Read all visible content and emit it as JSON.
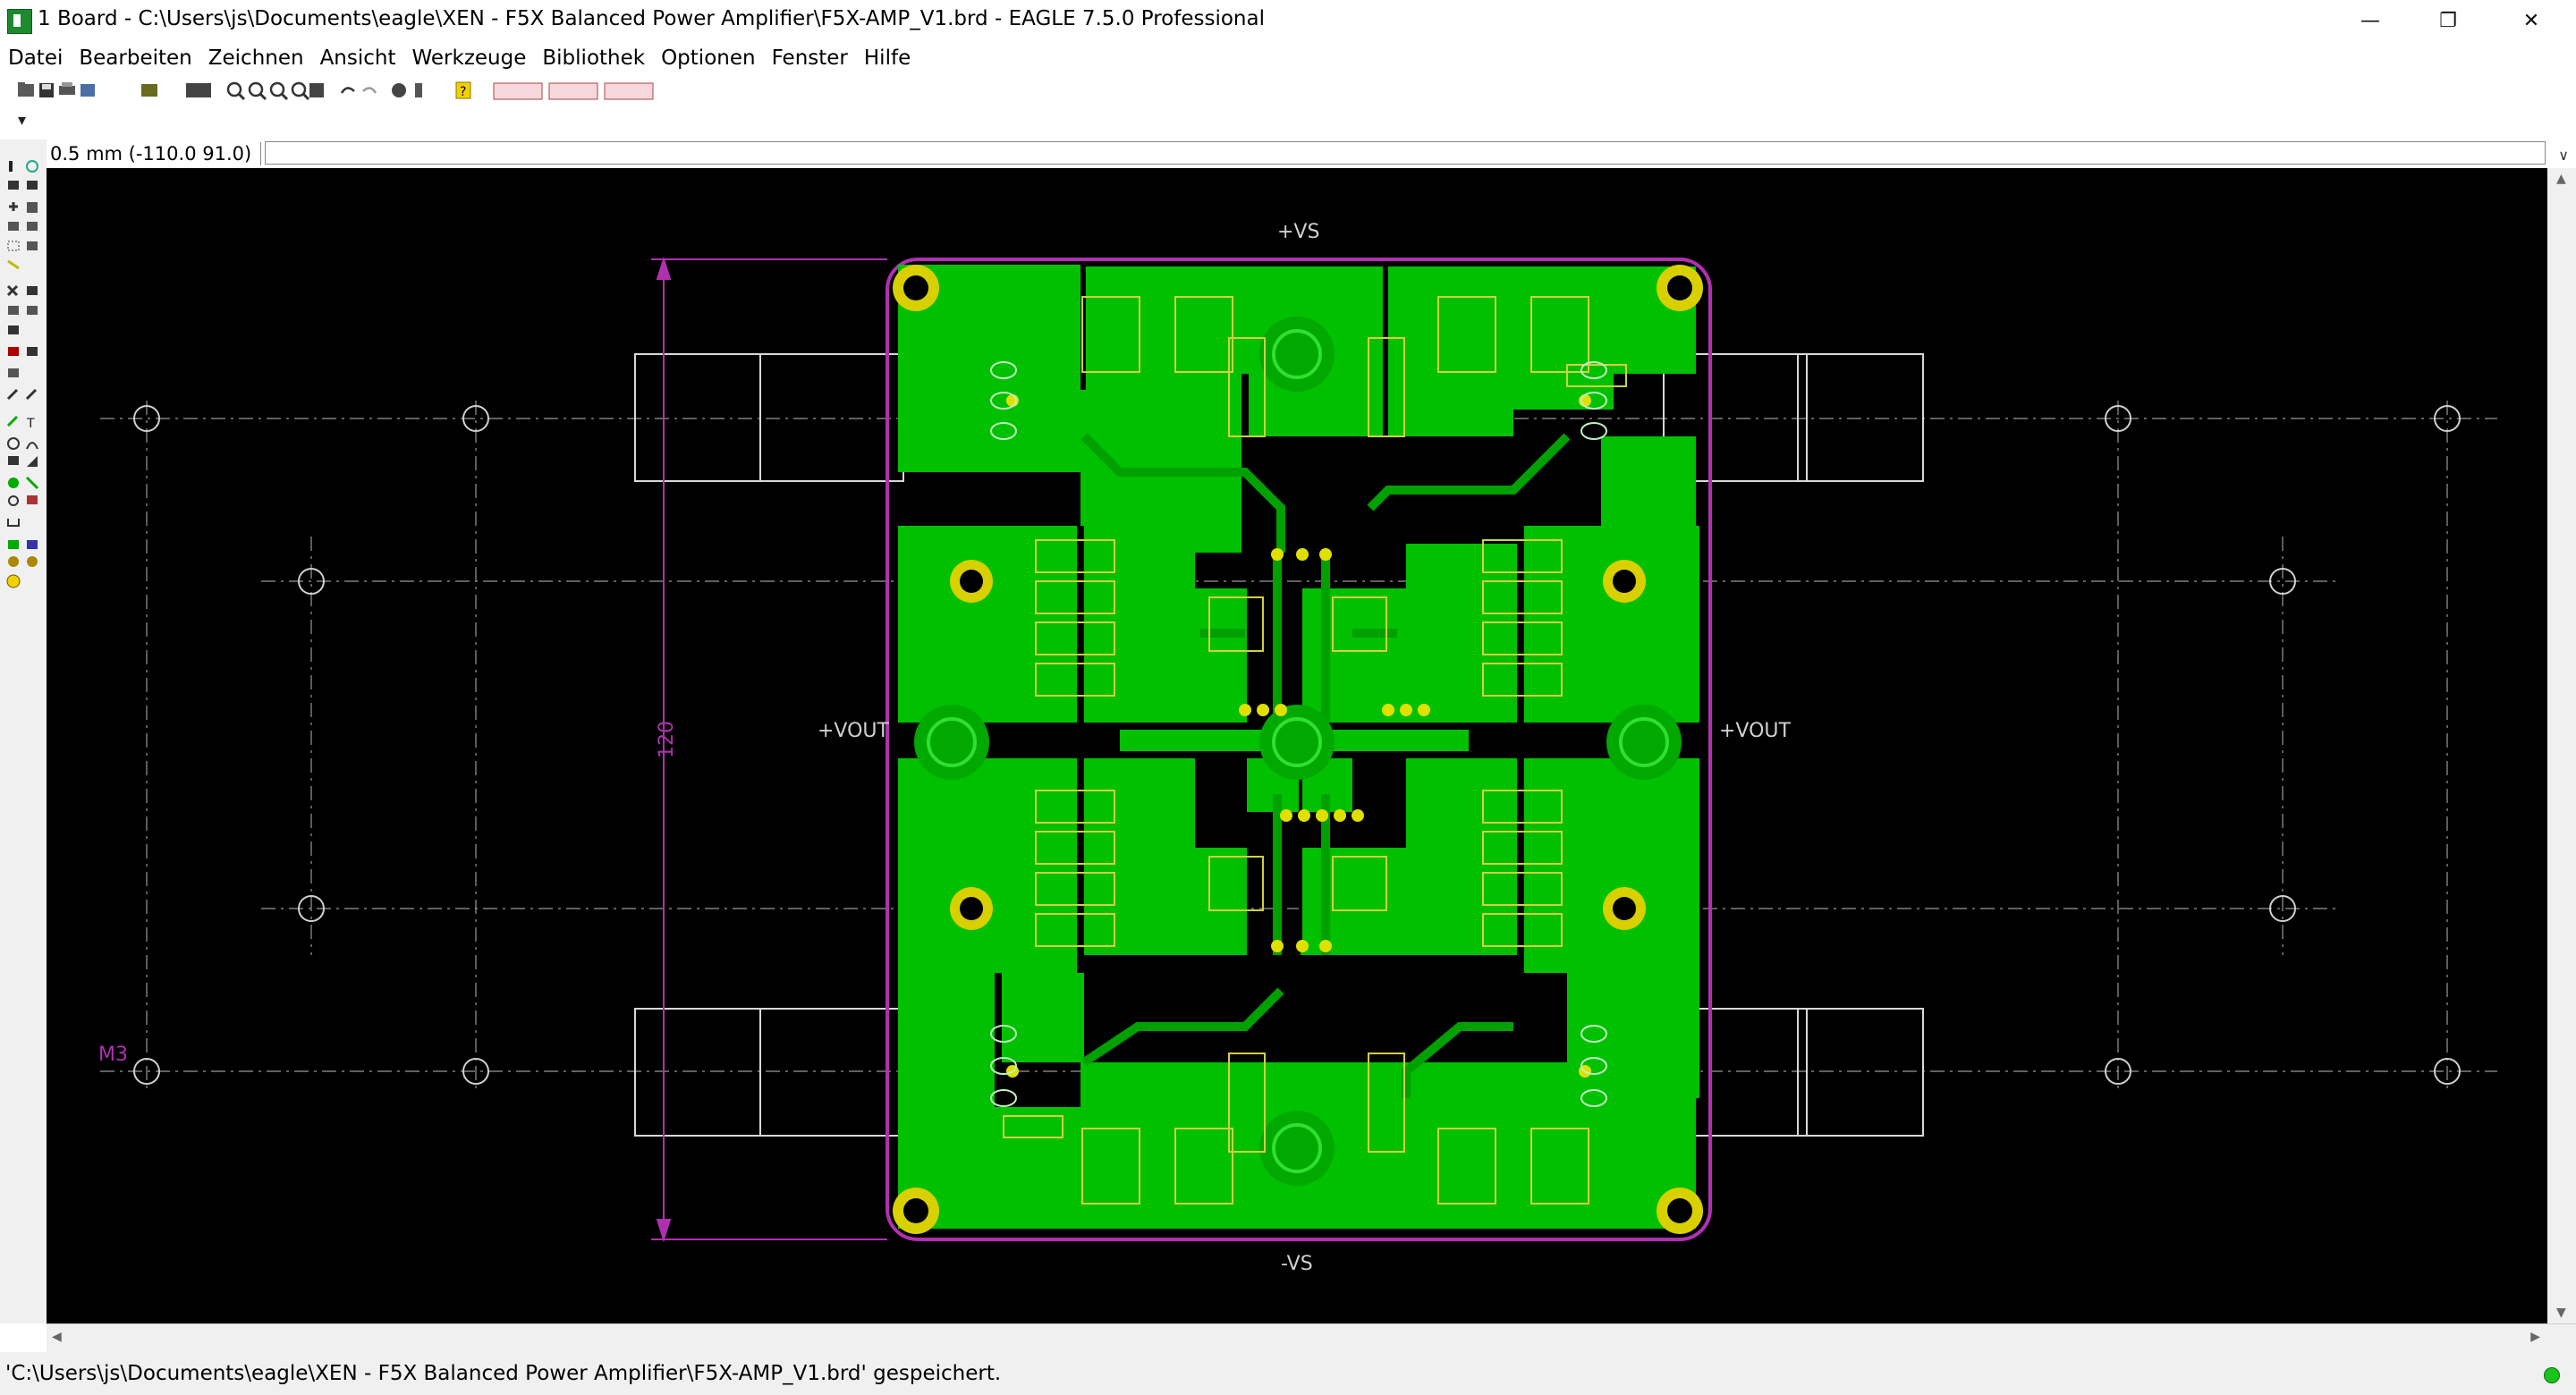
{
  "window": {
    "title": "1 Board - C:\\Users\\js\\Documents\\eagle\\XEN - F5X Balanced Power Amplifier\\F5X-AMP_V1.brd - EAGLE 7.5.0 Professional",
    "minimize_glyph": "—",
    "restore_glyph": "❐",
    "close_glyph": "✕"
  },
  "menu": {
    "items": [
      {
        "label": "Datei"
      },
      {
        "label": "Bearbeiten"
      },
      {
        "label": "Zeichnen"
      },
      {
        "label": "Ansicht"
      },
      {
        "label": "Werkzeuge"
      },
      {
        "label": "Bibliothek"
      },
      {
        "label": "Optionen"
      },
      {
        "label": "Fenster"
      },
      {
        "label": "Hilfe"
      }
    ]
  },
  "toolbar": {
    "buttons": [
      {
        "icon": "open-icon"
      },
      {
        "icon": "save-icon"
      },
      {
        "icon": "print-icon"
      },
      {
        "icon": "cam-icon"
      },
      {
        "icon": "schematic-icon"
      },
      {
        "icon": "run-ulp-icon"
      },
      {
        "icon": "run-script-icon"
      },
      {
        "icon": "zoom-fit-icon"
      },
      {
        "icon": "zoom-in-icon"
      },
      {
        "icon": "zoom-out-icon"
      },
      {
        "icon": "zoom-redraw-icon"
      },
      {
        "icon": "zoom-select-icon"
      },
      {
        "icon": "undo-icon"
      },
      {
        "icon": "redo-icon"
      },
      {
        "icon": "stop-icon"
      },
      {
        "icon": "go-icon"
      },
      {
        "icon": "help-icon"
      }
    ],
    "grid_dropdown_glyph": "▾"
  },
  "command_line": {
    "coordinate_readout": "0.5 mm (-110.0 91.0)",
    "input_value": "",
    "dropdown_glyph": "∨"
  },
  "board": {
    "labels": {
      "vs_top": "+VS",
      "vs_bottom": "-VS",
      "vout_left": "+VOUT",
      "vout_right": "+VOUT",
      "dimension": "120",
      "hole_label": "M3"
    },
    "colors": {
      "canvas_bg": "#000000",
      "copper_fill": "#00c800",
      "copper_trace": "#00a000",
      "silkscreen": "#c8c840",
      "outline": "#b030b0",
      "dimension": "#b030b0",
      "pad": "#e0e000",
      "hole_outline": "#d0d0d0",
      "center_line": "#9a9a9a"
    }
  },
  "status": {
    "message": "'C:\\Users\\js\\Documents\\eagle\\XEN - F5X Balanced Power Amplifier\\F5X-AMP_V1.brd' gespeichert.",
    "indicator_color": "#19c41b"
  }
}
